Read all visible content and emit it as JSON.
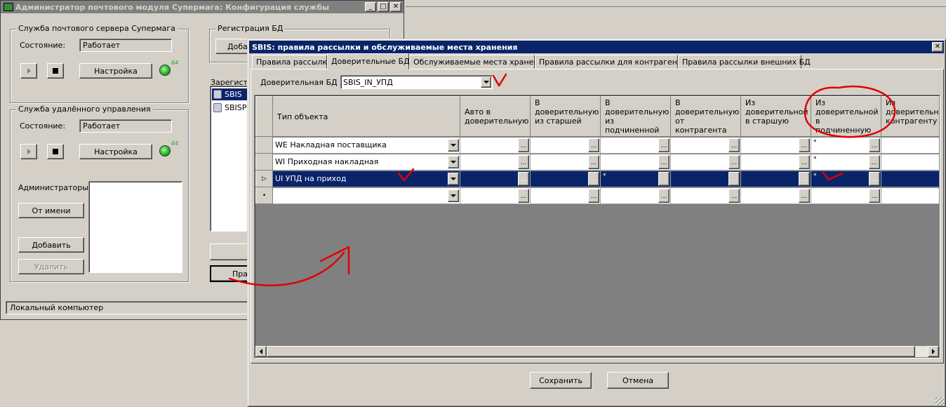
{
  "back_window": {
    "title": "Администратор почтового модуля Супермага: Конфигурация службы",
    "mail_group": {
      "title": "Служба почтового сервера Супермага",
      "state_label": "Состояние:",
      "state_value": "Работает",
      "settings_button": "Настройка"
    },
    "remote_group": {
      "title": "Служба удалённого управления",
      "state_label": "Состояние:",
      "state_value": "Работает",
      "settings_button": "Настройка",
      "admins_label": "Администраторы:",
      "on_behalf_button": "От имени",
      "add_button": "Добавить",
      "delete_button": "Удалить"
    },
    "db_group": {
      "title": "Регистрация БД",
      "add_button_partial": "Добав"
    },
    "registered_label": "Зарегист",
    "db_list": [
      "SBIS",
      "SBISP"
    ],
    "rules_button_partial": "Пра",
    "status_bar": "Локальный компьютер"
  },
  "dialog": {
    "title": "SBIS: правила рассылки и обслуживаемые места хранения",
    "tabs": [
      "Правила рассылки",
      "Доверительные БД",
      "Обслуживаемые места хранения",
      "Правила рассылки для контрагентов",
      "Правила рассылки внешних БД"
    ],
    "active_tab": 1,
    "trusted_db_label": "Доверительная БД :",
    "trusted_db_value": "SBIS_IN_УПД",
    "columns": [
      "Тип объекта",
      "Авто в доверительную",
      "В доверительную из старшей",
      "В доверительную из подчиненной",
      "В доверительную от контрагента",
      "Из доверительной в старшую",
      "Из доверительной в подчиненную",
      "Из доверительной контрагенту"
    ],
    "rows": [
      {
        "indicator": "",
        "type": "WE Накладная поставщика",
        "cells": [
          "",
          "",
          "",
          "",
          "",
          "*",
          ""
        ]
      },
      {
        "indicator": "",
        "type": "WI Приходная накладная",
        "cells": [
          "",
          "",
          "",
          "",
          "",
          "*",
          ""
        ]
      },
      {
        "indicator": "▷",
        "type": "UI УПД на приход",
        "cells": [
          "",
          "",
          "*",
          "",
          "",
          "*",
          ""
        ],
        "selected": true
      },
      {
        "indicator": "•",
        "type": "",
        "cells": [
          "",
          "",
          "",
          "",
          "",
          "",
          ""
        ]
      }
    ],
    "save_button": "Сохранить",
    "cancel_button": "Отмена"
  },
  "colors": {
    "titlebar_active": "#0a246a",
    "titlebar_inactive": "#808080",
    "selection": "#0a246a",
    "annotation": "#e00000"
  }
}
